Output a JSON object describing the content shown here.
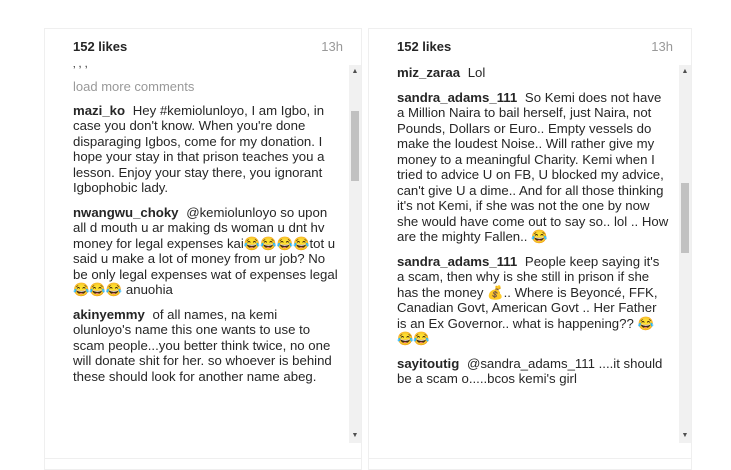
{
  "left": {
    "likes": "152 likes",
    "time": "13h",
    "load_more": "load more comments",
    "comments": [
      {
        "user": "mazi_ko",
        "text": "Hey #kemiolunloyo, I am Igbo, in case you don't know. When you're done disparaging Igbos, come for my donation. I hope your stay in that prison teaches you a lesson. Enjoy your stay there, you ignorant Igbophobic lady."
      },
      {
        "user": "nwangwu_choky",
        "text": "@kemiolunloyo so upon all d mouth u ar making ds woman u dnt hv money for legal expenses kai😂😂😂😂tot u said u make a lot of money from ur job? No be only legal expenses wat of expenses legal 😂😂😂 anuohia"
      },
      {
        "user": "akinyemmy",
        "text": "of all names, na kemi olunloyo's name this one wants to use to scam people...you better think twice, no one will donate shit for her. so whoever is behind these should look for another name abeg."
      }
    ]
  },
  "right": {
    "likes": "152 likes",
    "time": "13h",
    "comments": [
      {
        "user": "miz_zaraa",
        "text": "Lol"
      },
      {
        "user": "sandra_adams_111",
        "text": "So Kemi does not have a Million Naira to bail herself, just Naira, not Pounds, Dollars or Euro.. Empty vessels do make the loudest Noise.. Will rather give my money to a meaningful Charity. Kemi when I tried to advice U on FB, U blocked my advice, can't give U a dime.. And for all those thinking it's not Kemi, if she was not the one by now she would have come out to say so.. lol .. How are the mighty Fallen.. 😂"
      },
      {
        "user": "sandra_adams_111",
        "text": "People keep saying it's a scam, then why is she still in prison if she has the money 💰.. Where is Beyoncé, FFK, Canadian Govt, American Govt .. Her Father is an Ex Governor.. what is happening?? 😂😂😂"
      },
      {
        "user": "sayitoutig",
        "text": "@sandra_adams_111 ....it should be a scam o.....bcos kemi's girl"
      }
    ]
  },
  "icons": {
    "scroll_up": "triangle-up-icon",
    "scroll_down": "triangle-down-icon"
  }
}
